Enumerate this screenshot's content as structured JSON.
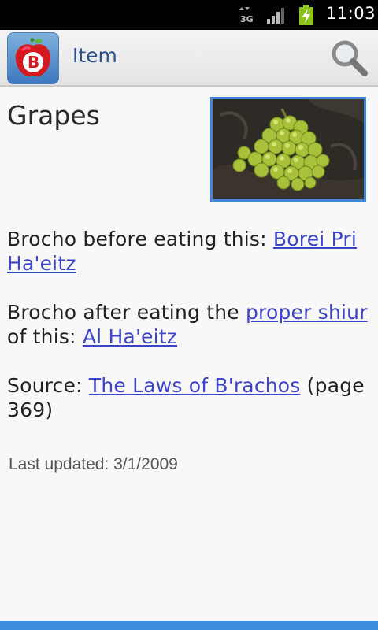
{
  "status_bar": {
    "network": "3G",
    "time": "11:03"
  },
  "action_bar": {
    "app_icon_letter": "B",
    "title": "Item",
    "search_icon": "search-icon"
  },
  "item": {
    "title": "Grapes",
    "photo": "grapes-photo",
    "before": {
      "prefix": "Brocho before eating this: ",
      "link": "Borei Pri Ha'eitz"
    },
    "after": {
      "prefix": "Brocho after eating the ",
      "link1": "proper shiur",
      "middle": " of this: ",
      "link2": "Al Ha'eitz"
    },
    "source": {
      "prefix": "Source: ",
      "link": "The Laws of B'rachos",
      "suffix": " (page 369)"
    },
    "last_updated": "Last updated: 3/1/2009"
  },
  "colors": {
    "link": "#3c44c8",
    "title": "#2b4e8c",
    "accent": "#3c8de0"
  }
}
